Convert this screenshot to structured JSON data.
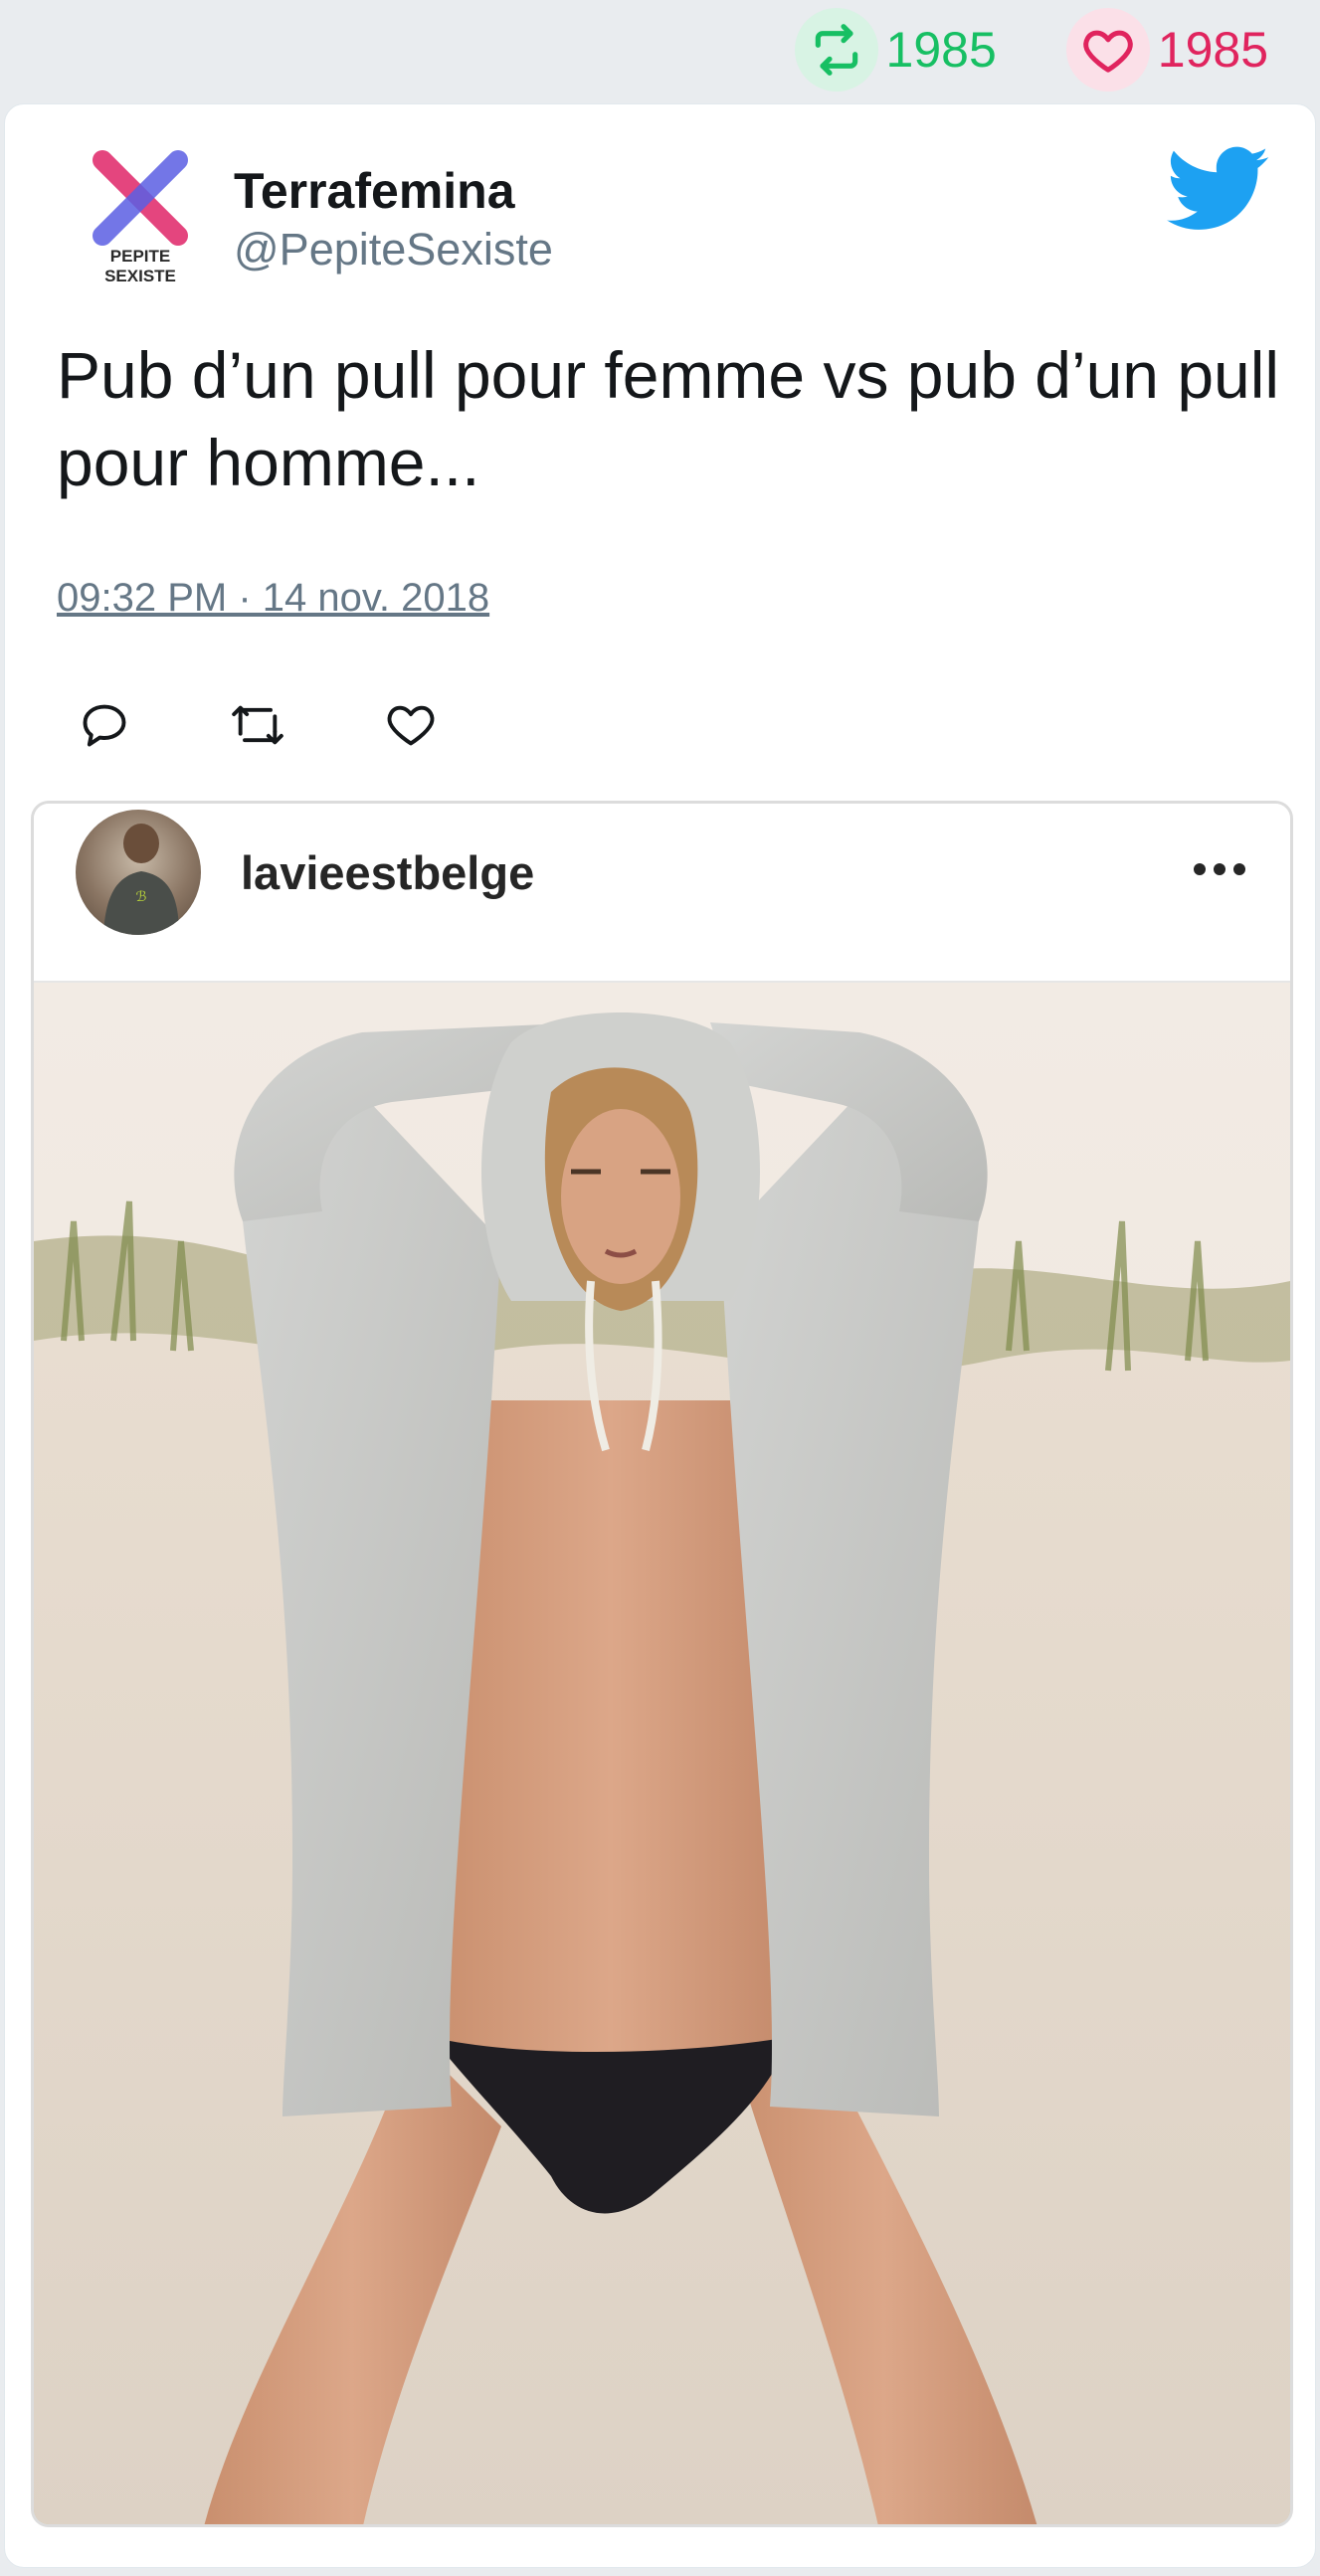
{
  "stats": {
    "retweets": "1985",
    "likes": "1985",
    "retweet_icon": "retweet-icon",
    "like_icon": "heart-icon",
    "retweet_color": "#17bf63",
    "like_color": "#e0245e"
  },
  "tweet": {
    "author_name": "Terrafemina",
    "author_handle": "@PepiteSexiste",
    "avatar_text_line1": "PEPITE",
    "avatar_text_line2": "SEXISTE",
    "text": "Pub d’un pull pour femme vs pub d’un pull pour homme...",
    "timestamp": "09:32 PM · 14 nov. 2018",
    "platform_icon": "twitter-bird-icon",
    "brand_color": "#1da1f2"
  },
  "actions": [
    {
      "name": "reply",
      "icon": "reply-icon"
    },
    {
      "name": "retweet",
      "icon": "retweet-icon"
    },
    {
      "name": "like",
      "icon": "heart-icon"
    }
  ],
  "embed": {
    "username": "lavieestbelge",
    "more_icon": "more-options-icon"
  }
}
